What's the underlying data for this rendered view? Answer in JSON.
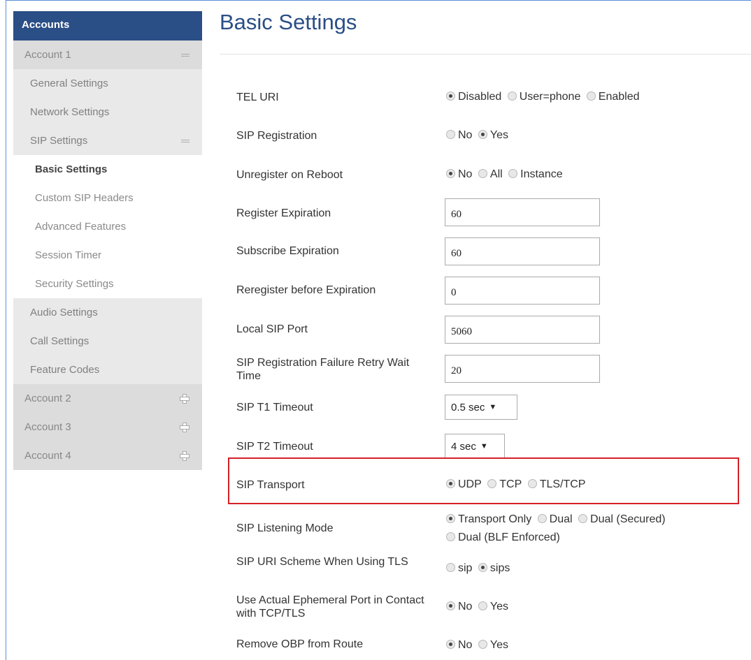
{
  "sidebar": {
    "header": "Accounts",
    "account1": "Account 1",
    "items": [
      {
        "label": "General Settings"
      },
      {
        "label": "Network Settings"
      },
      {
        "label": "SIP Settings"
      }
    ],
    "sub_items": [
      {
        "label": "Basic Settings"
      },
      {
        "label": "Custom SIP Headers"
      },
      {
        "label": "Advanced Features"
      },
      {
        "label": "Session Timer"
      },
      {
        "label": "Security Settings"
      }
    ],
    "more_items": [
      {
        "label": "Audio Settings"
      },
      {
        "label": "Call Settings"
      },
      {
        "label": "Feature Codes"
      }
    ],
    "accounts": [
      {
        "label": "Account 2"
      },
      {
        "label": "Account 3"
      },
      {
        "label": "Account 4"
      }
    ]
  },
  "main": {
    "title": "Basic Settings",
    "tel_uri": {
      "label": "TEL URI",
      "options": [
        "Disabled",
        "User=phone",
        "Enabled"
      ],
      "selected": "Disabled"
    },
    "sip_registration": {
      "label": "SIP Registration",
      "options": [
        "No",
        "Yes"
      ],
      "selected": "Yes"
    },
    "unregister_on_reboot": {
      "label": "Unregister on Reboot",
      "options": [
        "No",
        "All",
        "Instance"
      ],
      "selected": "No"
    },
    "register_expiration": {
      "label": "Register Expiration",
      "value": "60"
    },
    "subscribe_expiration": {
      "label": "Subscribe Expiration",
      "value": "60"
    },
    "reregister_before_expiration": {
      "label": "Reregister before Expiration",
      "value": "0"
    },
    "local_sip_port": {
      "label": "Local SIP Port",
      "value": "5060"
    },
    "retry_wait_time": {
      "label": "SIP Registration Failure Retry Wait Time",
      "value": "20"
    },
    "t1_timeout": {
      "label": "SIP T1 Timeout",
      "value": "0.5 sec"
    },
    "t2_timeout": {
      "label": "SIP T2 Timeout",
      "value": "4 sec"
    },
    "sip_transport": {
      "label": "SIP Transport",
      "options": [
        "UDP",
        "TCP",
        "TLS/TCP"
      ],
      "selected": "UDP"
    },
    "listening_mode": {
      "label": "SIP Listening Mode",
      "options": [
        "Transport Only",
        "Dual",
        "Dual (Secured)",
        "Dual (BLF Enforced)"
      ],
      "selected": "Transport Only"
    },
    "uri_scheme": {
      "label": "SIP URI Scheme When Using TLS",
      "options": [
        "sip",
        "sips"
      ],
      "selected": "sips"
    },
    "ephemeral_port": {
      "label": "Use Actual Ephemeral Port in Contact with TCP/TLS",
      "options": [
        "No",
        "Yes"
      ],
      "selected": "No"
    },
    "remove_obp": {
      "label": "Remove OBP from Route",
      "options": [
        "No",
        "Yes"
      ],
      "selected": "No"
    }
  },
  "colors": {
    "header": "#2a4e86",
    "highlight": "#d42027",
    "title": "#2a4e86"
  }
}
